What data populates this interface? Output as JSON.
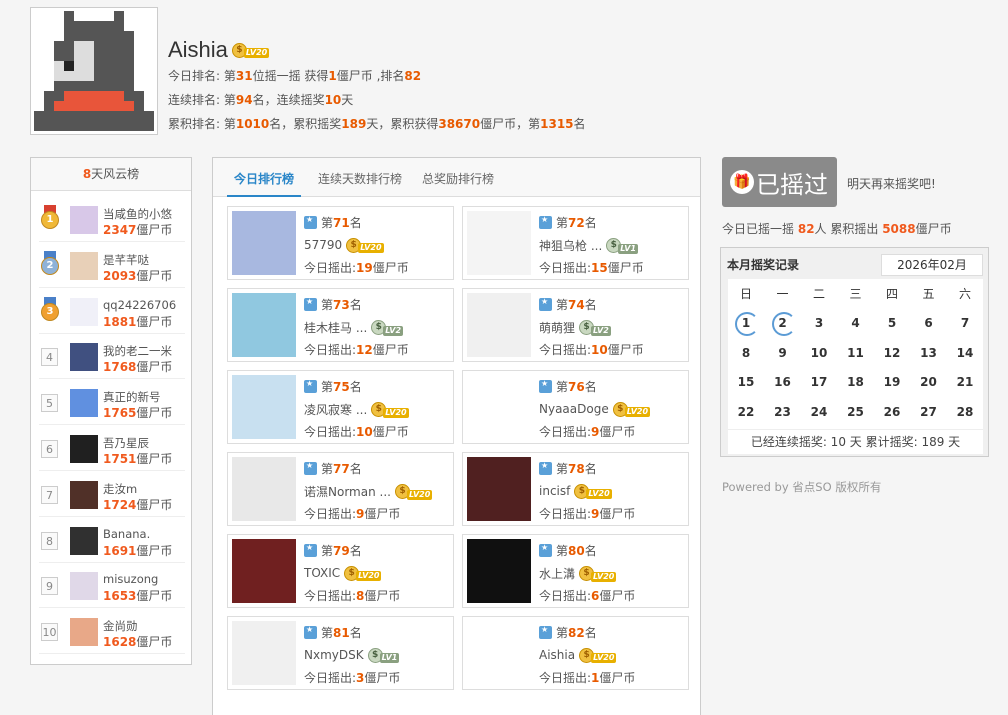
{
  "colors": {
    "accent": "#2a86c8",
    "highlight": "#e85a00",
    "button_gray": "#8a8a8a"
  },
  "header": {
    "username": "Aishia",
    "level_badge": "LV20",
    "line1": {
      "a": "今日排名: 第",
      "rank": "31",
      "b": "位摇一摇 获得",
      "coins": "1",
      "c": "僵尸币 ,排名",
      "rank2": "82"
    },
    "line2": {
      "a": "连续排名: 第",
      "rank": "94",
      "b": "名，连续摇奖",
      "days": "10",
      "c": "天"
    },
    "line3": {
      "a": "累积排名: 第",
      "rank": "1010",
      "b": "名，累积摇奖",
      "days": "189",
      "c": "天，累积获得",
      "coins": "38670",
      "d": "僵尸币，第",
      "rank2": "1315",
      "e": "名"
    }
  },
  "wind": {
    "title_num": "8",
    "title_text": "天风云榜",
    "unit": "僵尸币",
    "items": [
      {
        "rank": "1",
        "name": "当咸鱼的小悠",
        "coins": "2347"
      },
      {
        "rank": "2",
        "name": "是芊芊哒",
        "coins": "2093"
      },
      {
        "rank": "3",
        "name": "qq24226706",
        "coins": "1881"
      },
      {
        "rank": "4",
        "name": "我的老二一米",
        "coins": "1768"
      },
      {
        "rank": "5",
        "name": "真正的新号",
        "coins": "1765"
      },
      {
        "rank": "6",
        "name": "吾乃星辰",
        "coins": "1751"
      },
      {
        "rank": "7",
        "name": "走汝m",
        "coins": "1724"
      },
      {
        "rank": "8",
        "name": "Banana.",
        "coins": "1691"
      },
      {
        "rank": "9",
        "name": "misuzong",
        "coins": "1653"
      },
      {
        "rank": "10",
        "name": "金尚勋",
        "coins": "1628"
      }
    ]
  },
  "tabs": [
    "今日排行榜",
    "连续天数排行榜",
    "总奖励排行榜"
  ],
  "cards_text": {
    "rank_prefix": "第",
    "rank_suffix": "名",
    "shake_label": "今日摇出:",
    "unit": "僵尸币"
  },
  "cards": [
    {
      "rank": "71",
      "name": "57790",
      "badge": "LV20",
      "shake": "19"
    },
    {
      "rank": "72",
      "name": "神狙乌枪 ...",
      "badge": "LV1",
      "shake": "15"
    },
    {
      "rank": "73",
      "name": "桂木桂马 ...",
      "badge": "LV2",
      "shake": "12"
    },
    {
      "rank": "74",
      "name": "萌萌狸",
      "badge": "LV2",
      "shake": "10"
    },
    {
      "rank": "75",
      "name": "凌风寂寒 ...",
      "badge": "LV20",
      "shake": "10"
    },
    {
      "rank": "76",
      "name": "NyaaaDoge",
      "badge": "LV20",
      "shake": "9"
    },
    {
      "rank": "77",
      "name": "诺濕Norman ...",
      "badge": "LV20",
      "shake": "9"
    },
    {
      "rank": "78",
      "name": "incisf",
      "badge": "LV20",
      "shake": "9"
    },
    {
      "rank": "79",
      "name": "TOXIC",
      "badge": "LV20",
      "shake": "8"
    },
    {
      "rank": "80",
      "name": "水上溝",
      "badge": "LV20",
      "shake": "6"
    },
    {
      "rank": "81",
      "name": "NxmyDSK",
      "badge": "LV1",
      "shake": "3"
    },
    {
      "rank": "82",
      "name": "Aishia",
      "badge": "LV20",
      "shake": "1"
    }
  ],
  "shake_button": {
    "label": "已摇过"
  },
  "tomorrow_text": "明天再来摇奖吧!",
  "summary": {
    "a": "今日已摇一摇",
    "people": "82",
    "b": "人 累积摇出",
    "coins": "5088",
    "c": "僵尸币"
  },
  "calendar": {
    "title": "本月摇奖记录",
    "month": "2026年02月",
    "weekdays": [
      "日",
      "一",
      "二",
      "三",
      "四",
      "五",
      "六"
    ],
    "days": [
      "1",
      "2",
      "3",
      "4",
      "5",
      "6",
      "7",
      "8",
      "9",
      "10",
      "11",
      "12",
      "13",
      "14",
      "15",
      "16",
      "17",
      "18",
      "19",
      "20",
      "21",
      "22",
      "23",
      "24",
      "25",
      "26",
      "27",
      "28"
    ],
    "signed_days": [
      "1",
      "2"
    ],
    "footer": "已经连续摇奖:  10 天 累计摇奖:  189 天"
  },
  "powered": "Powered by 省点SO 版权所有"
}
